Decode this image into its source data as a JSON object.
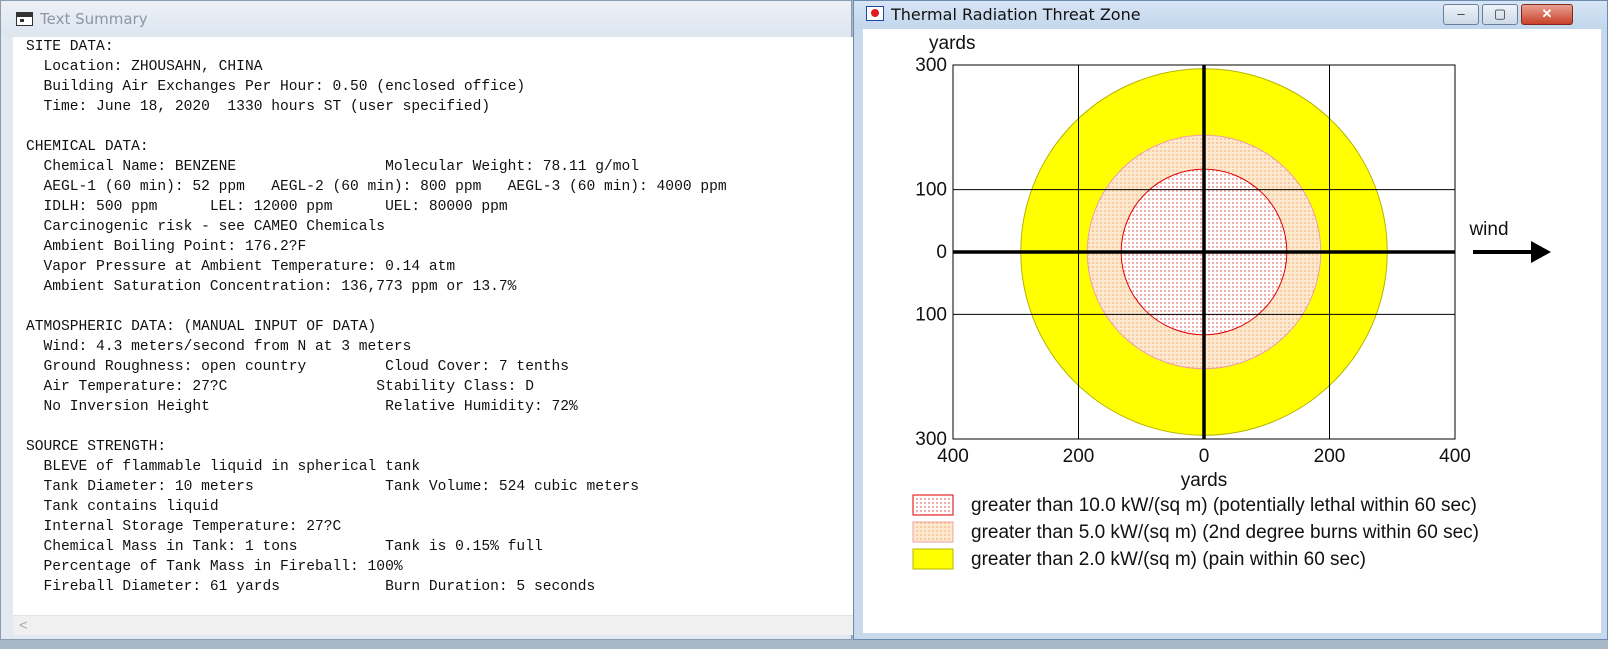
{
  "text_window": {
    "title": "Text Summary",
    "lines": [
      "SITE DATA:",
      "  Location: ZHOUSAHN, CHINA",
      "  Building Air Exchanges Per Hour: 0.50 (enclosed office)",
      "  Time: June 18, 2020  1330 hours ST (user specified)",
      "",
      "CHEMICAL DATA:",
      "  Chemical Name: BENZENE                 Molecular Weight: 78.11 g/mol",
      "  AEGL-1 (60 min): 52 ppm   AEGL-2 (60 min): 800 ppm   AEGL-3 (60 min): 4000 ppm",
      "  IDLH: 500 ppm      LEL: 12000 ppm      UEL: 80000 ppm",
      "  Carcinogenic risk - see CAMEO Chemicals",
      "  Ambient Boiling Point: 176.2?F",
      "  Vapor Pressure at Ambient Temperature: 0.14 atm",
      "  Ambient Saturation Concentration: 136,773 ppm or 13.7%",
      "",
      "ATMOSPHERIC DATA: (MANUAL INPUT OF DATA)",
      "  Wind: 4.3 meters/second from N at 3 meters",
      "  Ground Roughness: open country         Cloud Cover: 7 tenths",
      "  Air Temperature: 27?C                 Stability Class: D",
      "  No Inversion Height                    Relative Humidity: 72%",
      "",
      "SOURCE STRENGTH:",
      "  BLEVE of flammable liquid in spherical tank",
      "  Tank Diameter: 10 meters               Tank Volume: 524 cubic meters",
      "  Tank contains liquid",
      "  Internal Storage Temperature: 27?C",
      "  Chemical Mass in Tank: 1 tons          Tank is 0.15% full",
      "  Percentage of Tank Mass in Fireball: 100%",
      "  Fireball Diameter: 61 yards            Burn Duration: 5 seconds"
    ],
    "scroll_left_arrow": "<"
  },
  "plot_window": {
    "title": "Thermal Radiation Threat Zone",
    "buttons": {
      "minimize": "–",
      "maximize": "▢",
      "close": "✕"
    }
  },
  "chart_data": {
    "type": "threat-zone-circles",
    "axis_unit_label": "yards",
    "xlim": [
      -400,
      400
    ],
    "ylim": [
      -300,
      300
    ],
    "x_ticks": [
      {
        "value": -400,
        "label": "400"
      },
      {
        "value": -200,
        "label": "200"
      },
      {
        "value": 0,
        "label": "0"
      },
      {
        "value": 200,
        "label": "200"
      },
      {
        "value": 400,
        "label": "400"
      }
    ],
    "y_ticks": [
      {
        "value": 300,
        "label": "300"
      },
      {
        "value": 100,
        "label": "100"
      },
      {
        "value": 0,
        "label": "0"
      },
      {
        "value": -100,
        "label": "100"
      },
      {
        "value": -300,
        "label": "300"
      }
    ],
    "wind_label": "wind",
    "zones": [
      {
        "radius_yards": 292,
        "fill": "#ffff00",
        "stroke": "#b5b500",
        "pattern": "solid",
        "legend": "greater than 2.0 kW/(sq m) (pain within 60 sec)"
      },
      {
        "radius_yards": 186,
        "fill": "#fde3c4",
        "stroke": "#f0a0a0",
        "pattern": "dots-orange",
        "legend": "greater than 5.0 kW/(sq m) (2nd degree burns within 60 sec)"
      },
      {
        "radius_yards": 132,
        "fill": "#ffffff",
        "stroke": "#e00000",
        "pattern": "dots-red",
        "legend": "greater than 10.0 kW/(sq m) (potentially lethal within 60 sec)"
      }
    ]
  }
}
